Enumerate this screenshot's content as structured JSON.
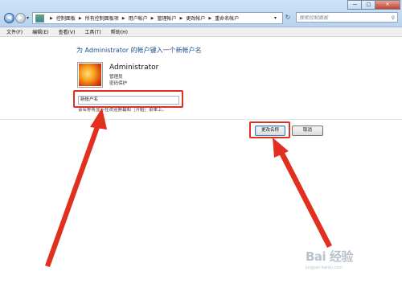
{
  "window": {
    "breadcrumbs": [
      "控制面板",
      "所有控制面板项",
      "用户帐户",
      "管理帐户",
      "更改帐户",
      "重命名帐户"
    ],
    "search_placeholder": "搜索控制面板",
    "controls": {
      "minimize": "—",
      "maximize": "□",
      "close": "✕"
    }
  },
  "menu": [
    "文件(F)",
    "编辑(E)",
    "查看(V)",
    "工具(T)",
    "帮助(H)"
  ],
  "page": {
    "heading": "为 Administrator 的帐户键入一个新帐户名",
    "account": {
      "name": "Administrator",
      "type": "管理员",
      "protection": "密码保护"
    },
    "new_name_input": "新帐户名",
    "hint": "该名称将显示在欢迎屏幕和［开始］菜单上。",
    "buttons": {
      "change": "更改名称",
      "cancel": "取消"
    }
  },
  "watermark": {
    "logo": "Bai 经验",
    "url": "jingyan.baidu.com"
  },
  "annotation_color": "#e23020"
}
